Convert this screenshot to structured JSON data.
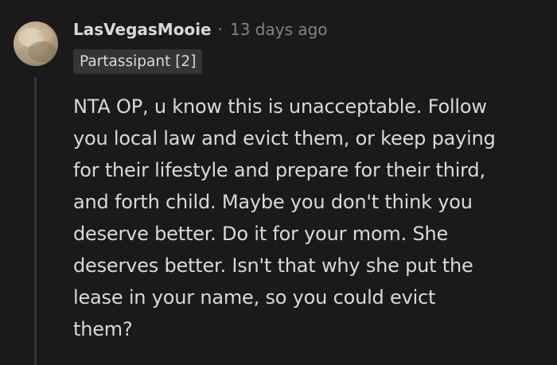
{
  "comment": {
    "author": "LasVegasMooie",
    "separator": "·",
    "timestamp": "13 days ago",
    "flair": "Partassipant [2]",
    "body_lines": [
      "NTA OP, u know this is unacceptable. Follow",
      "you local law and evict them, or keep paying",
      "for their lifestyle and prepare for their third,",
      "and forth child. Maybe you don't think you",
      "deserve better. Do it for your mom. She",
      "deserves better. Isn't that why she put the",
      "lease in your name, so you could evict",
      "them?"
    ]
  },
  "colors": {
    "background": "#1a1a1b",
    "text": "#d7dadc",
    "meta": "#818384",
    "flair_bg": "#343536",
    "thread_line": "#343536"
  },
  "icons": {
    "avatar": "user-avatar-image"
  }
}
